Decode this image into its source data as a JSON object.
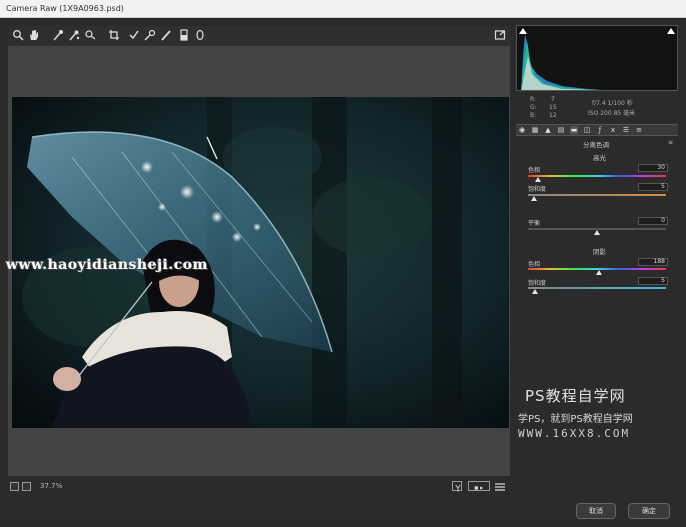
{
  "window": {
    "title": "Camera Raw (1X9A0963.psd)"
  },
  "toolbar": {
    "tools": [
      "zoom-icon",
      "hand-icon",
      "white-balance-icon",
      "color-sampler-icon",
      "targeted-adjust-icon",
      "crop-icon",
      "straighten-icon",
      "spot-removal-icon",
      "red-eye-icon",
      "brush-icon",
      "graduated-filter-icon",
      "radial-filter-icon"
    ],
    "fullscreen_icon": "fullscreen-icon"
  },
  "watermark_url": "www.haoyidiansheji.com",
  "readout": {
    "r_label": "R:",
    "r_value": "7",
    "g_label": "G:",
    "g_value": "15",
    "b_label": "B:",
    "b_value": "12",
    "line1": "f/7.4  1/100 秒",
    "line2": "ISO 200  85 毫米"
  },
  "panel": {
    "section_title": "分离色调",
    "highlights_title": "高光",
    "shadows_title": "阴影",
    "hl_hue_label": "色相",
    "hl_hue_value": "30",
    "hl_sat_label": "饱和度",
    "hl_sat_value": "5",
    "balance_label": "平衡",
    "balance_value": "0",
    "sh_hue_label": "色相",
    "sh_hue_value": "188",
    "sh_sat_label": "饱和度",
    "sh_sat_value": "5"
  },
  "bottombar": {
    "zoom": "37.7%"
  },
  "footer": {
    "cancel": "取消",
    "ok": "确定"
  },
  "brand_watermark": {
    "title": "PS教程自学网",
    "subtitle": "学PS，就到PS教程自学网",
    "site": "WWW.16XX8.COM"
  },
  "colors": {
    "accent": "#3aa0ff",
    "panel_bg": "#2b2b2b",
    "preview_bg": "#444444"
  }
}
